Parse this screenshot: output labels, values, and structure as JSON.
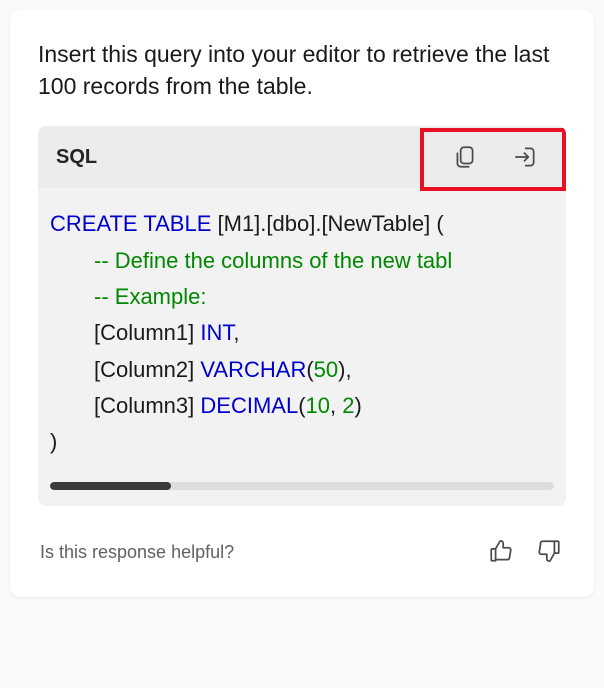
{
  "instruction": "Insert this query into your editor to retrieve the last 100 records from the table.",
  "codeBlock": {
    "language": "SQL",
    "lines": [
      {
        "indent": 0,
        "segments": [
          {
            "cls": "kw",
            "text": "CREATE TABLE"
          },
          {
            "cls": "txt",
            "text": " [M1].[dbo].[NewTable] ("
          }
        ]
      },
      {
        "indent": 1,
        "segments": [
          {
            "cls": "comment",
            "text": "-- Define the columns of the new tabl"
          }
        ]
      },
      {
        "indent": 1,
        "segments": [
          {
            "cls": "comment",
            "text": "-- Example:"
          }
        ]
      },
      {
        "indent": 1,
        "segments": [
          {
            "cls": "txt",
            "text": "[Column1] "
          },
          {
            "cls": "kw",
            "text": "INT"
          },
          {
            "cls": "txt",
            "text": ","
          }
        ]
      },
      {
        "indent": 1,
        "segments": [
          {
            "cls": "txt",
            "text": "[Column2] "
          },
          {
            "cls": "kw",
            "text": "VARCHAR"
          },
          {
            "cls": "txt",
            "text": "("
          },
          {
            "cls": "num",
            "text": "50"
          },
          {
            "cls": "txt",
            "text": "),"
          }
        ]
      },
      {
        "indent": 1,
        "segments": [
          {
            "cls": "txt",
            "text": "[Column3] "
          },
          {
            "cls": "kw",
            "text": "DECIMAL"
          },
          {
            "cls": "txt",
            "text": "("
          },
          {
            "cls": "num",
            "text": "10"
          },
          {
            "cls": "txt",
            "text": ", "
          },
          {
            "cls": "num",
            "text": "2"
          },
          {
            "cls": "txt",
            "text": ")"
          }
        ]
      },
      {
        "indent": 0,
        "segments": [
          {
            "cls": "txt",
            "text": ")"
          }
        ]
      }
    ]
  },
  "feedback": {
    "prompt": "Is this response helpful?"
  }
}
